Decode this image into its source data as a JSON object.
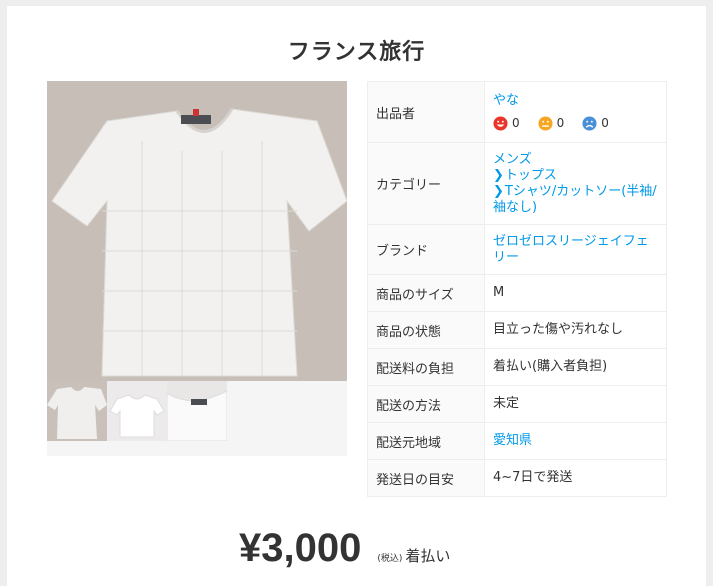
{
  "item": {
    "title": "フランス旅行",
    "price": "¥3,000",
    "tax_note": "(税込)",
    "shipping_note": "着払い"
  },
  "details": {
    "seller_label": "出品者",
    "seller_name": "やな",
    "ratings": [
      {
        "icon": "smile-face-icon",
        "count": "0",
        "color": "#ea352d"
      },
      {
        "icon": "neutral-face-icon",
        "count": "0",
        "color": "#f5a623"
      },
      {
        "icon": "sad-face-icon",
        "count": "0",
        "color": "#4a90d9"
      }
    ],
    "category_label": "カテゴリー",
    "category": [
      "メンズ",
      "トップス",
      "Tシャツ/カットソー(半袖/袖なし)"
    ],
    "category_chevron": "❯",
    "brand_label": "ブランド",
    "brand": "ゼロゼロスリージェイフェリー",
    "size_label": "商品のサイズ",
    "size": "M",
    "condition_label": "商品の状態",
    "condition": "目立った傷や汚れなし",
    "fee_label": "配送料の負担",
    "fee": "着払い(購入者負担)",
    "method_label": "配送の方法",
    "method": "未定",
    "origin_label": "配送元地域",
    "origin": "愛知県",
    "days_label": "発送日の目安",
    "days": "4~7日で発送"
  }
}
